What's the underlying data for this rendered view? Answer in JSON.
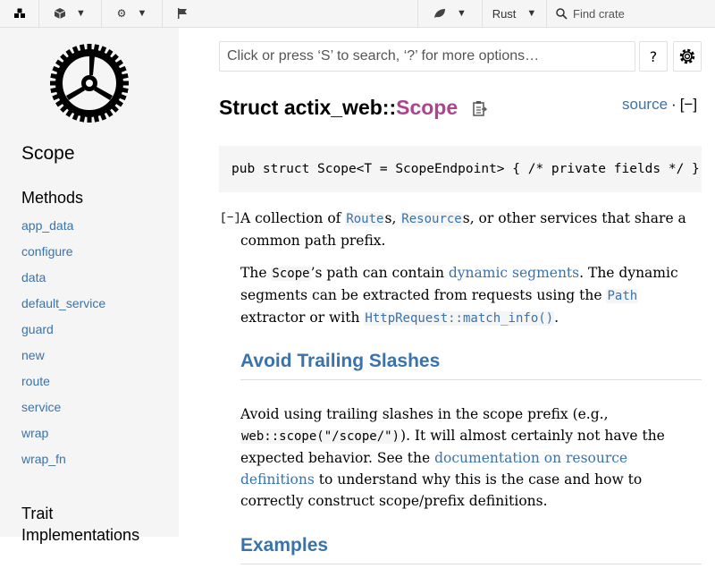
{
  "topbar": {
    "rustdoc_icon": "rustdoc-logo-icon",
    "crate_icon": "cube-icon",
    "settings_icon": "gears-icon",
    "flag_icon": "flag-icon",
    "leaf_icon": "leaf-icon",
    "language_label": "Rust",
    "find_crate_placeholder": "Find crate"
  },
  "sidebar": {
    "title": "Scope",
    "methods_heading": "Methods",
    "methods": [
      "app_data",
      "configure",
      "data",
      "default_service",
      "guard",
      "new",
      "route",
      "service",
      "wrap",
      "wrap_fn"
    ],
    "trait_heading_line1": "Trait",
    "trait_heading_line2": "Implementations"
  },
  "search": {
    "placeholder": "Click or press ‘S’ to search, ‘?’ for more options…",
    "help_label": "?"
  },
  "main": {
    "heading_prefix": "Struct actix_web::",
    "heading_name": "Scope",
    "source_label": "source",
    "source_sep": "·",
    "collapse_all": "[−]",
    "code": "pub struct Scope<T = ScopeEndpoint> { /* private fields */ }",
    "collapse_toggle": "[−]",
    "p1": {
      "t1": "A collection of ",
      "route": "Route",
      "t2": "s, ",
      "resource": "Resource",
      "t3": "s, or other services that share a common path prefix."
    },
    "p2": {
      "t1": "The ",
      "scope": "Scope",
      "t2": "’s path can contain ",
      "link1": "dynamic segments",
      "t3": ". The dynamic segments can be extracted from requests using the ",
      "path": "Path",
      "t4": " extractor or with ",
      "match_info": "HttpRequest::match_info()",
      "t5": "."
    },
    "h_avoid": "Avoid Trailing Slashes",
    "p3": {
      "t1": "Avoid using trailing slashes in the scope prefix (e.g., ",
      "code": "web::scope(\"/scope/\")",
      "t2": "). It will almost certainly not have the expected behavior. See the ",
      "link": "documentation on resource definitions",
      "t3": " to understand why this is the case and how to correctly construct scope/prefix definitions."
    },
    "h_examples": "Examples"
  },
  "colors": {
    "link": "#3873ad",
    "struct_name": "#ad448e",
    "sidebar_bg": "#f5f5f5"
  }
}
